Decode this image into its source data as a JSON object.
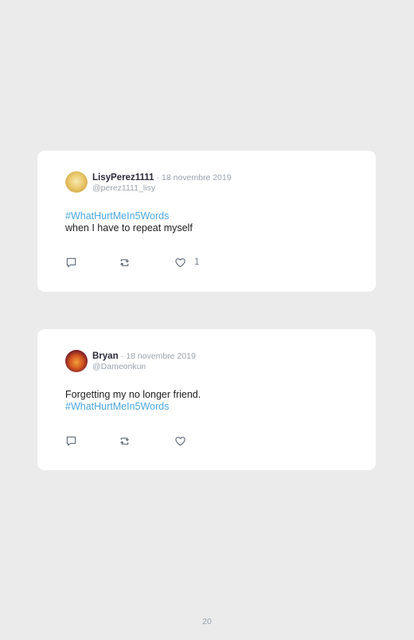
{
  "tweets": [
    {
      "name": "LisyPerez1111",
      "date": "· 18 novembre 2019",
      "handle": "@perez1111_lisy",
      "line1": "#WhatHurtMeIn5Words",
      "line2": "when I have to repeat myself",
      "like_count": "1"
    },
    {
      "name": "Bryan",
      "date": "· 18 novembre 2019",
      "handle": "@Dameonkun",
      "line1": "Forgetting my no longer friend.",
      "line2": "#WhatHurtMeIn5Words",
      "like_count": ""
    }
  ],
  "page_number": "20",
  "icons": [
    "reply-icon",
    "retweet-icon",
    "heart-icon"
  ],
  "colors": {
    "hashtag": "#4aa7df",
    "muted": "#9aa3ad",
    "background": "#ebebeb"
  }
}
